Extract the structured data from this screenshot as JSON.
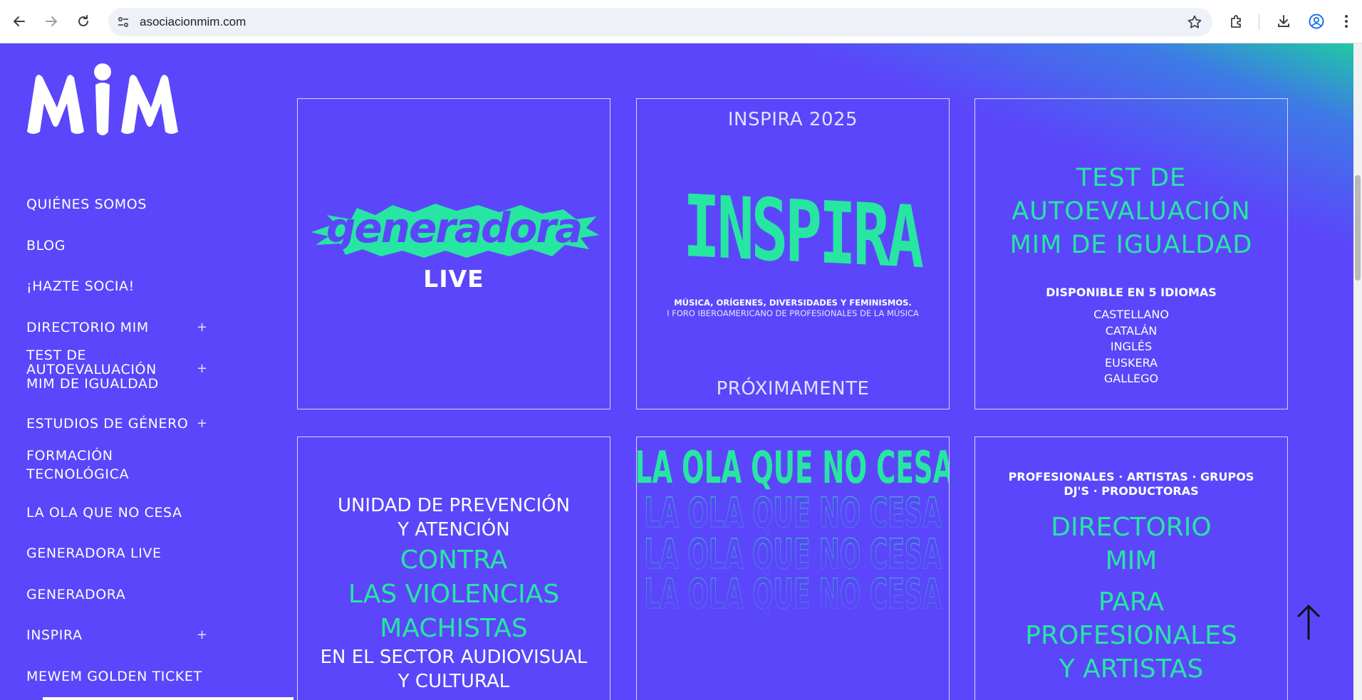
{
  "browser": {
    "url": "asociacionmim.com",
    "icons": [
      "back-arrow-icon",
      "forward-arrow-icon",
      "reload-icon",
      "site-info-icon",
      "bookmark-star-icon",
      "extensions-icon",
      "download-icon",
      "profile-icon",
      "more-menu-icon"
    ]
  },
  "site": {
    "logo_text": "MIM",
    "menu": [
      {
        "label": "QUIÉNES SOMOS",
        "has_sub": false
      },
      {
        "label": "BLOG",
        "has_sub": false
      },
      {
        "label": "¡HAZTE SOCIA!",
        "has_sub": false
      },
      {
        "label": "DIRECTORIO MIM",
        "has_sub": true
      },
      {
        "label": "TEST DE AUTOEVALUACIÓN MIM DE IGUALDAD",
        "lines": [
          "TEST DE",
          "AUTOEVALUACIÓN",
          "MIM DE IGUALDAD"
        ],
        "has_sub": true
      },
      {
        "label": "ESTUDIOS DE GÉNERO",
        "has_sub": true
      },
      {
        "label": "FORMACIÓN TECNOLÓGICA",
        "lines": [
          "FORMACIÓN",
          "TECNOLÓGICA"
        ],
        "has_sub": false
      },
      {
        "label": "LA OLA QUE NO CESA",
        "has_sub": false
      },
      {
        "label": "GENERADORA LIVE",
        "has_sub": false
      },
      {
        "label": "GENERADORA",
        "has_sub": false
      },
      {
        "label": "INSPIRA",
        "has_sub": true
      },
      {
        "label": "MEWEM GOLDEN TICKET",
        "has_sub": false
      }
    ],
    "plus_symbol": "+"
  },
  "cards": {
    "generadora": {
      "logo_text": "generadora",
      "subtitle": "LIVE"
    },
    "inspira": {
      "top": "INSPIRA 2025",
      "logo_text": "INSPIRA",
      "tagline": "MÚSICA, ORÍGENES, DIVERSIDADES Y FEMINISMOS.",
      "subtagline": "I FORO IBEROAMERICANO DE PROFESIONALES DE LA MÚSICA",
      "bottom": "PRÓXIMAMENTE"
    },
    "test": {
      "title_lines": [
        "TEST DE",
        "AUTOEVALUACIÓN",
        "MIM DE IGUALDAD"
      ],
      "available": "DISPONIBLE EN 5 IDIOMAS",
      "languages": [
        "CASTELLANO",
        "CATALÁN",
        "INGLÉS",
        "EUSKERA",
        "GALLEGO"
      ]
    },
    "unidad": {
      "line1": "UNIDAD DE PREVENCIÓN",
      "line2": "Y ATENCIÓN",
      "green_lines": [
        "CONTRA",
        "LAS VIOLENCIAS",
        "MACHISTAS"
      ],
      "line3": "EN EL SECTOR AUDIOVISUAL",
      "line4": "Y CULTURAL"
    },
    "ola": {
      "title": "LA OLA QUE NO CESA"
    },
    "directorio": {
      "top_line1": "PROFESIONALES · ARTISTAS · GRUPOS",
      "top_line2": "DJ'S · PRODUCTORAS",
      "green_lines": [
        "DIRECTORIO",
        "MIM",
        "PARA",
        "PROFESIONALES",
        "Y ARTISTAS"
      ]
    }
  },
  "colors": {
    "background": "#5b46fb",
    "accent_green": "#27e6a2",
    "teal_corner": "#1fc9a5"
  }
}
